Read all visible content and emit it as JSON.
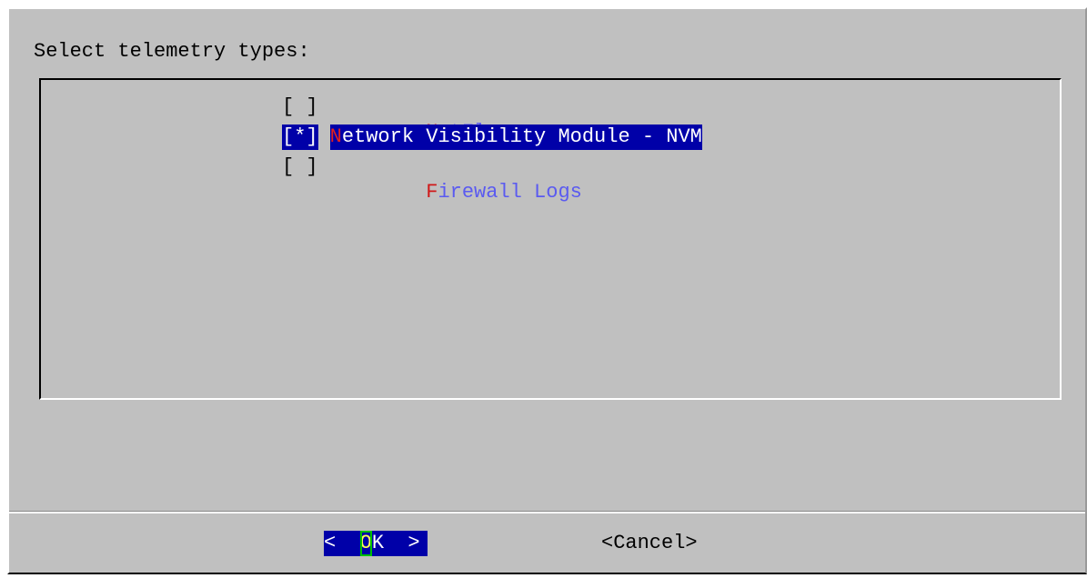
{
  "dialog": {
    "prompt": "Select telemetry types:"
  },
  "checklist": {
    "items": [
      {
        "check": "[ ]",
        "hot": "N",
        "rest": "etFlow",
        "selected": false,
        "checked": false
      },
      {
        "check": "[*]",
        "hot": "N",
        "rest": "etwork Visibility Module - NVM",
        "selected": true,
        "checked": true
      },
      {
        "check": "[ ]",
        "hot": "F",
        "rest": "irewall Logs",
        "selected": false,
        "checked": false
      }
    ]
  },
  "buttons": {
    "ok_left": "<  ",
    "ok_hot": "O",
    "ok_rest": "K  >",
    "cancel": "<Cancel>"
  },
  "colors": {
    "background": "#c0c0c0",
    "selection": "#0000a8",
    "hotkey": "#d01818",
    "item_text": "#5a5af0"
  }
}
